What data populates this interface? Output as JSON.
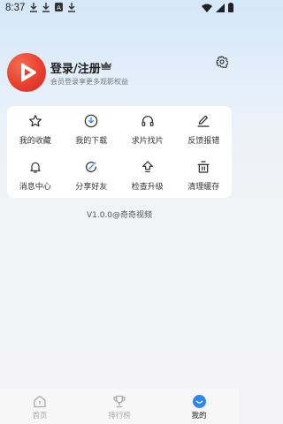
{
  "status": {
    "time": "8:37"
  },
  "profile": {
    "title": "登录/注册",
    "subtitle": "会员登录享更多观影权益"
  },
  "grid": [
    {
      "label": "我的收藏",
      "icon": "star-icon"
    },
    {
      "label": "我的下载",
      "icon": "download-icon"
    },
    {
      "label": "求片找片",
      "icon": "headphones-icon"
    },
    {
      "label": "反馈报错",
      "icon": "edit-icon"
    },
    {
      "label": "消息中心",
      "icon": "bell-icon"
    },
    {
      "label": "分享好友",
      "icon": "share-icon"
    },
    {
      "label": "检查升级",
      "icon": "upgrade-icon"
    },
    {
      "label": "清理缓存",
      "icon": "trash-icon"
    }
  ],
  "version": "V1.0.0@奇奇视频",
  "tabs": [
    {
      "label": "首页",
      "icon": "home-icon",
      "active": false
    },
    {
      "label": "排行榜",
      "icon": "trophy-icon",
      "active": false
    },
    {
      "label": "我的",
      "icon": "profile-icon",
      "active": true
    }
  ],
  "colors": {
    "accent": "#2f86f0",
    "brand_red": "#e8402e",
    "text": "#222222"
  }
}
